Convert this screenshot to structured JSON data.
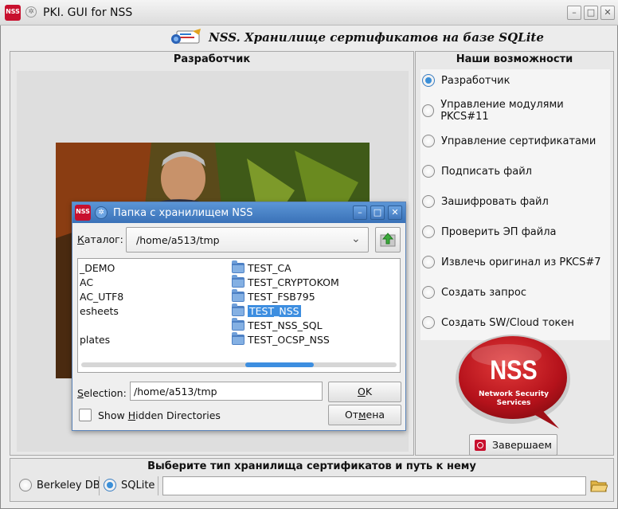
{
  "window": {
    "title": "PKI. GUI for NSS",
    "app_badge": "NSS",
    "min_glyph": "–",
    "max_glyph": "□",
    "close_glyph": "✕"
  },
  "header": {
    "title": "NSS. Хранилище сертификатов на базе SQLite"
  },
  "left_panel": {
    "title": "Разработчик"
  },
  "right_panel": {
    "title": "Наши возможности",
    "options": [
      {
        "label": "Разработчик",
        "selected": true
      },
      {
        "label": "Управление модулями PKCS#11",
        "selected": false
      },
      {
        "label": "Управление сертификатами",
        "selected": false
      },
      {
        "label": "Подписать файл",
        "selected": false
      },
      {
        "label": "Зашифровать файл",
        "selected": false
      },
      {
        "label": "Проверить ЭП файла",
        "selected": false
      },
      {
        "label": "Извлечь оригинал из PKCS#7",
        "selected": false
      },
      {
        "label": "Создать запрос",
        "selected": false
      },
      {
        "label": "Создать SW/Cloud токен",
        "selected": false
      }
    ],
    "logo": {
      "main": "NSS",
      "line1": "Network Security",
      "line2": "Services"
    },
    "finish_button": "Завершаем"
  },
  "bottom": {
    "title": "Выберите тип хранилища сертификатов и путь к нему",
    "db_options": [
      {
        "label": "Berkeley DB",
        "selected": false
      },
      {
        "label": "SQLite",
        "selected": true
      }
    ],
    "path_value": ""
  },
  "dialog": {
    "title": "Папка с хранилищем NSS",
    "catalog_label_u": "К",
    "catalog_label_rest": "аталог:",
    "catalog_value": "/home/a513/tmp",
    "left_items": [
      "_DEMO",
      "AC",
      "AC_UTF8",
      "esheets",
      "",
      "plates"
    ],
    "right_items": [
      "TEST_CA",
      "TEST_CRYPTOKOM",
      "TEST_FSB795",
      "TEST_NSS",
      "TEST_NSS_SQL",
      "TEST_OCSP_NSS"
    ],
    "selected_item": "TEST_NSS",
    "selection_label_u": "S",
    "selection_label_rest": "election:",
    "selection_value": "/home/a513/tmp",
    "ok_u": "O",
    "ok_rest": "K",
    "show_hidden_a": "Show ",
    "show_hidden_u": "H",
    "show_hidden_b": "idden Directories",
    "cancel_a": "От",
    "cancel_u": "м",
    "cancel_b": "ена"
  },
  "colors": {
    "accent": "#3b8fd8",
    "dialog_title": "#4a82c6",
    "brand_red": "#c8102e"
  }
}
